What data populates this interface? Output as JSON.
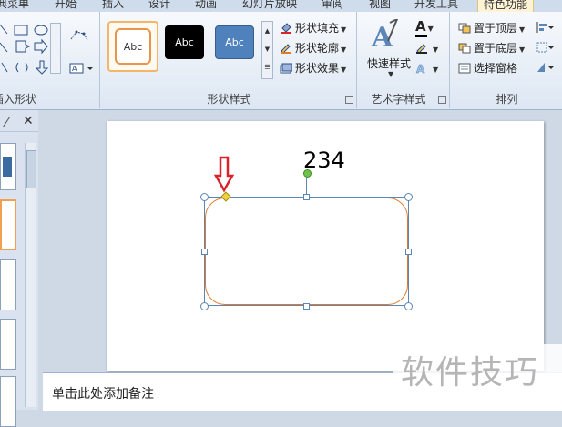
{
  "ribbon_tabs": [
    {
      "label": "典菜单",
      "active": false
    },
    {
      "label": "开始",
      "active": false
    },
    {
      "label": "插入",
      "active": false
    },
    {
      "label": "设计",
      "active": false
    },
    {
      "label": "动画",
      "active": false
    },
    {
      "label": "幻灯片放映",
      "active": false
    },
    {
      "label": "审阅",
      "active": false
    },
    {
      "label": "视图",
      "active": false
    },
    {
      "label": "开发工具",
      "active": false
    },
    {
      "label": "特色功能",
      "active": true
    }
  ],
  "groups": {
    "insert_shapes": {
      "label": "插入形状"
    },
    "shape_styles": {
      "label": "形状样式",
      "presets": [
        "Abc",
        "Abc",
        "Abc"
      ],
      "fill": "形状填充",
      "outline": "形状轮廓",
      "effects": "形状效果"
    },
    "wordart": {
      "label": "艺术字样式",
      "quick_styles": "快速样式",
      "text_fill_glyph": "A"
    },
    "arrange": {
      "label": "排列",
      "bring_front": "置于顶层",
      "send_back": "置于底层",
      "selection_pane": "选择窗格"
    }
  },
  "slide": {
    "annotation_text": "234"
  },
  "notes": {
    "placeholder": "单击此处添加备注"
  },
  "watermark": "软件技巧",
  "colors": {
    "shape_outline": "#e07a2a",
    "handle": "#5b86b7",
    "arrow": "#d9232a",
    "adjust_handle": "#f0d240",
    "rotate_handle": "#6fc24a"
  }
}
